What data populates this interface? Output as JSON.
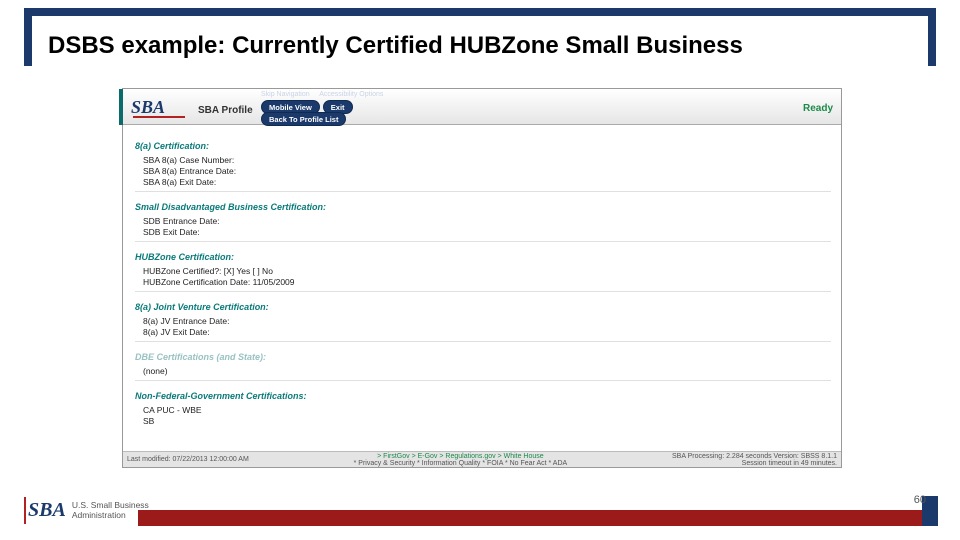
{
  "title": "DSBS example: Currently Certified HUBZone Small Business",
  "header": {
    "logo_text": "SBA",
    "profile_label": "SBA Profile",
    "skip_nav": "Skip Navigation",
    "access_opts": "Accessibility Options",
    "pill_mobile": "Mobile View",
    "pill_exit": "Exit",
    "pill_back": "Back To Profile List",
    "ready": "Ready"
  },
  "sections": {
    "s1": {
      "title": "8(a) Certification:"
    },
    "s1_fields": {
      "a": "SBA 8(a) Case Number:",
      "b": "SBA 8(a) Entrance Date:",
      "c": "SBA 8(a) Exit Date:"
    },
    "s2": {
      "title": "Small Disadvantaged Business Certification:"
    },
    "s2_fields": {
      "a": "SDB Entrance Date:",
      "b": "SDB Exit Date:"
    },
    "s3": {
      "title": "HUBZone Certification:"
    },
    "s3_fields": {
      "a": "HUBZone Certified?: [X] Yes [   ] No",
      "b": "HUBZone Certification Date: 11/05/2009"
    },
    "s4": {
      "title": "8(a) Joint Venture Certification:"
    },
    "s4_fields": {
      "a": "8(a) JV Entrance Date:",
      "b": "8(a) JV Exit Date:"
    },
    "s5": {
      "title": "DBE Certifications (and State):"
    },
    "s5_fields": {
      "a": "(none)"
    },
    "s6": {
      "title": "Non-Federal-Government Certifications:"
    },
    "s6_fields": {
      "a": "CA PUC - WBE",
      "b": "SB"
    }
  },
  "statusbar": {
    "last_modified": "Last modified: 07/22/2013 12:00:00 AM",
    "top_links": "> FirstGov   > E-Gov   > Regulations.gov   > White House",
    "legal": "* Privacy & Security  * Information Quality  * FOIA  * No Fear Act  * ADA",
    "processing": "SBA Processing:  2.284 seconds Version: SBSS 8.1.1",
    "session": "Session timeout in 49 minutes."
  },
  "footer": {
    "mark": "SBA",
    "org1": "U.S. Small Business",
    "org2": "Administration",
    "page_number": "60"
  }
}
